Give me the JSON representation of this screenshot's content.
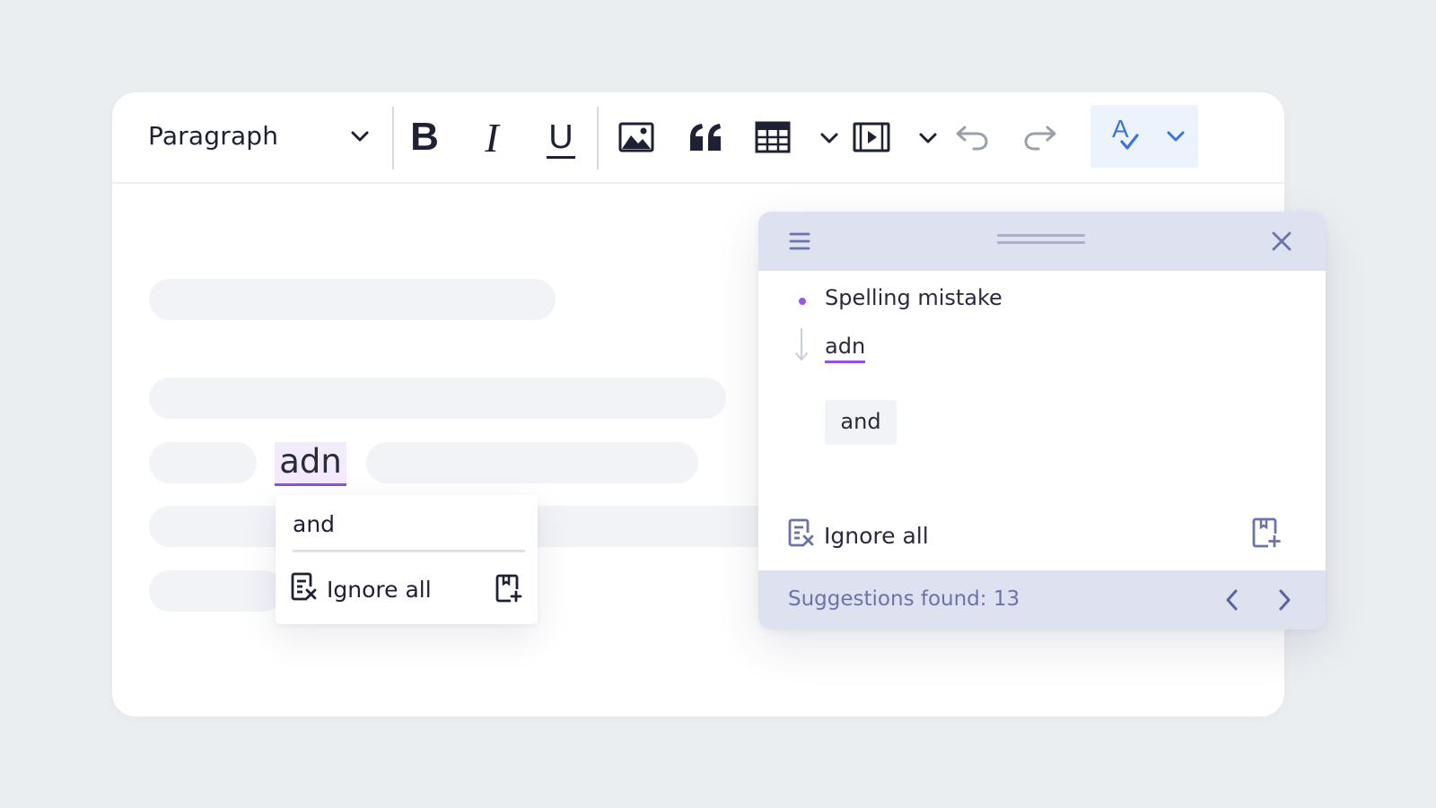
{
  "toolbar": {
    "paragraph_label": "Paragraph",
    "bold_label": "B",
    "italic_label": "I",
    "underline_label": "U",
    "spell_icon_letter": "A"
  },
  "editor": {
    "misspelled_word": "adn",
    "popup": {
      "suggestion": "and",
      "ignore_all_label": "Ignore all"
    }
  },
  "panel": {
    "category": "Spelling mistake",
    "word": "adn",
    "suggestion": "and",
    "ignore_all_label": "Ignore all",
    "footer_text": "Suggestions found: 13"
  },
  "colors": {
    "background": "#ebeef1",
    "accent_purple": "#8f4fe8",
    "spell_button_bg": "#edf3fd",
    "panel_header": "#dde1f0",
    "footer_text": "#6b74a8",
    "blue_icon": "#3b74e0"
  },
  "icons": [
    "chevron-down-icon",
    "image-icon",
    "quote-icon",
    "table-icon",
    "media-icon",
    "undo-icon",
    "redo-icon",
    "spellcheck-icon",
    "menu-icon",
    "close-icon",
    "ignore-all-icon",
    "add-to-dictionary-icon",
    "arrow-down-icon",
    "chevron-left-icon",
    "chevron-right-icon"
  ]
}
